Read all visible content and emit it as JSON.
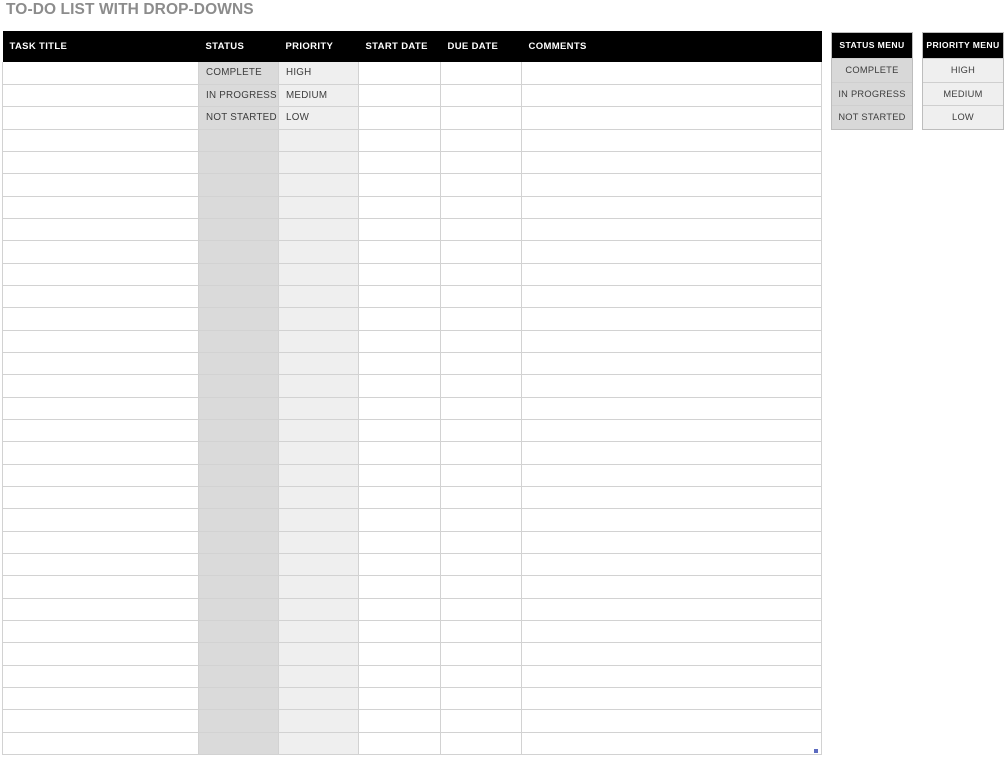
{
  "page": {
    "title": "TO-DO LIST WITH DROP-DOWNS"
  },
  "theme": {
    "title_color": "#8c8c8c",
    "header_bg": "#000000",
    "header_text": "#ffffff",
    "status_column_bg": "#dadada",
    "priority_column_bg": "#efefef",
    "grid_line": "#d2d2d2",
    "fill_handle": "#5c6bc0"
  },
  "table": {
    "columns": [
      {
        "key": "task_title",
        "label": "TASK TITLE"
      },
      {
        "key": "status",
        "label": "STATUS"
      },
      {
        "key": "priority",
        "label": "PRIORITY"
      },
      {
        "key": "start_date",
        "label": "START DATE"
      },
      {
        "key": "due_date",
        "label": "DUE DATE"
      },
      {
        "key": "comments",
        "label": "COMMENTS"
      }
    ],
    "row_count": 31,
    "rows": [
      {
        "task_title": "",
        "status": "COMPLETE",
        "priority": "HIGH",
        "start_date": "",
        "due_date": "",
        "comments": ""
      },
      {
        "task_title": "",
        "status": "IN PROGRESS",
        "priority": "MEDIUM",
        "start_date": "",
        "due_date": "",
        "comments": ""
      },
      {
        "task_title": "",
        "status": "NOT STARTED",
        "priority": "LOW",
        "start_date": "",
        "due_date": "",
        "comments": ""
      }
    ]
  },
  "status_menu": {
    "header": "STATUS MENU",
    "options": [
      "COMPLETE",
      "IN PROGRESS",
      "NOT STARTED"
    ]
  },
  "priority_menu": {
    "header": "PRIORITY MENU",
    "options": [
      "HIGH",
      "MEDIUM",
      "LOW"
    ]
  }
}
